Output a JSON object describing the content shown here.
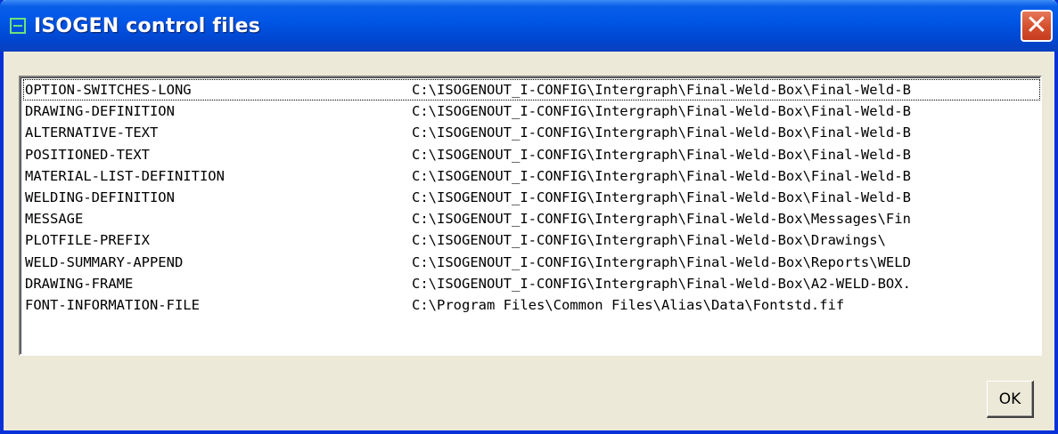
{
  "window": {
    "title": "ISOGEN control files",
    "close_glyph": "✕",
    "icon": "app-window-icon"
  },
  "files": [
    {
      "key": "OPTION-SWITCHES-LONG",
      "path": "C:\\ISOGENOUT_I-CONFIG\\Intergraph\\Final-Weld-Box\\Final-Weld-B"
    },
    {
      "key": "DRAWING-DEFINITION",
      "path": "C:\\ISOGENOUT_I-CONFIG\\Intergraph\\Final-Weld-Box\\Final-Weld-B"
    },
    {
      "key": "ALTERNATIVE-TEXT",
      "path": "C:\\ISOGENOUT_I-CONFIG\\Intergraph\\Final-Weld-Box\\Final-Weld-B"
    },
    {
      "key": "POSITIONED-TEXT",
      "path": "C:\\ISOGENOUT_I-CONFIG\\Intergraph\\Final-Weld-Box\\Final-Weld-B"
    },
    {
      "key": "MATERIAL-LIST-DEFINITION",
      "path": "C:\\ISOGENOUT_I-CONFIG\\Intergraph\\Final-Weld-Box\\Final-Weld-B"
    },
    {
      "key": "WELDING-DEFINITION",
      "path": "C:\\ISOGENOUT_I-CONFIG\\Intergraph\\Final-Weld-Box\\Final-Weld-B"
    },
    {
      "key": "MESSAGE",
      "path": "C:\\ISOGENOUT_I-CONFIG\\Intergraph\\Final-Weld-Box\\Messages\\Fin"
    },
    {
      "key": "PLOTFILE-PREFIX",
      "path": "C:\\ISOGENOUT_I-CONFIG\\Intergraph\\Final-Weld-Box\\Drawings\\"
    },
    {
      "key": "WELD-SUMMARY-APPEND",
      "path": "C:\\ISOGENOUT_I-CONFIG\\Intergraph\\Final-Weld-Box\\Reports\\WELD"
    },
    {
      "key": "DRAWING-FRAME",
      "path": "C:\\ISOGENOUT_I-CONFIG\\Intergraph\\Final-Weld-Box\\A2-WELD-BOX."
    },
    {
      "key": "FONT-INFORMATION-FILE",
      "path": "C:\\Program Files\\Common Files\\Alias\\Data\\Fontstd.fif"
    }
  ],
  "buttons": {
    "ok_label": "OK"
  },
  "colors": {
    "titlebar": "#0054e3",
    "close": "#d65230",
    "dialog_bg": "#ece9d8"
  }
}
